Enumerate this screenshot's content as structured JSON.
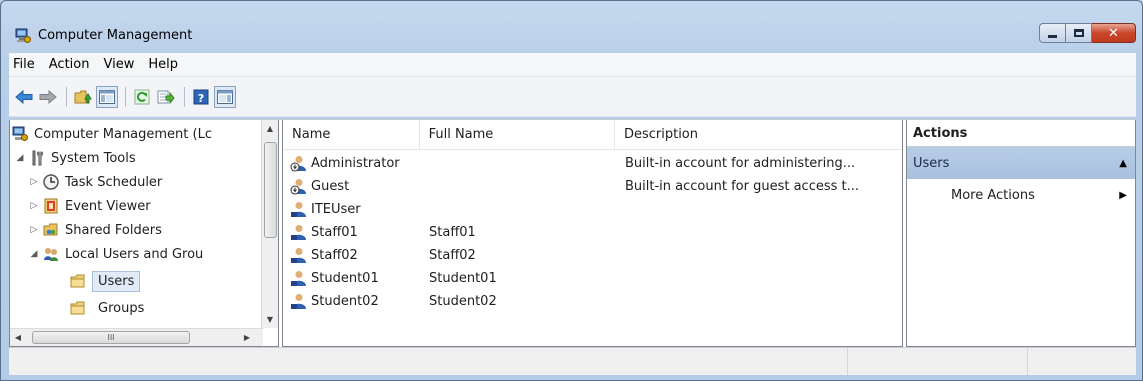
{
  "window": {
    "title": "Computer Management"
  },
  "menu": [
    "File",
    "Action",
    "View",
    "Help"
  ],
  "toolbar": {
    "buttons": [
      "back-arrow-icon",
      "forward-arrow-icon",
      "up-folder-icon",
      "show-hide-tree-icon",
      "refresh-icon",
      "export-list-icon",
      "help-icon",
      "show-hide-action-pane-icon"
    ]
  },
  "tree": {
    "items": [
      {
        "label": "Computer Management (Lc",
        "twisty": "",
        "icon": "computer-management-icon",
        "indent": 0
      },
      {
        "label": "System Tools",
        "twisty": "◢",
        "icon": "system-tools-icon",
        "indent": 1
      },
      {
        "label": "Task Scheduler",
        "twisty": "▷",
        "icon": "clock-icon",
        "indent": 2
      },
      {
        "label": "Event Viewer",
        "twisty": "▷",
        "icon": "event-viewer-icon",
        "indent": 2
      },
      {
        "label": "Shared Folders",
        "twisty": "▷",
        "icon": "shared-folder-icon",
        "indent": 2
      },
      {
        "label": "Local Users and Grou",
        "twisty": "◢",
        "icon": "users-groups-icon",
        "indent": 2
      },
      {
        "label": "Users",
        "twisty": "",
        "icon": "folder-icon",
        "indent": 3,
        "selected": true
      },
      {
        "label": "Groups",
        "twisty": "",
        "icon": "folder-icon",
        "indent": 3
      }
    ],
    "hscroll_thumb_glyph": "III"
  },
  "list": {
    "columns": [
      "Name",
      "Full Name",
      "Description"
    ],
    "rows": [
      {
        "name": "Administrator",
        "full_name": "",
        "description": "Built-in account for administering...",
        "icon": "disabled-user-icon"
      },
      {
        "name": "Guest",
        "full_name": "",
        "description": "Built-in account for guest access t...",
        "icon": "disabled-user-icon"
      },
      {
        "name": "ITEUser",
        "full_name": "",
        "description": "",
        "icon": "user-icon"
      },
      {
        "name": "Staff01",
        "full_name": "Staff01",
        "description": "",
        "icon": "user-icon"
      },
      {
        "name": "Staff02",
        "full_name": "Staff02",
        "description": "",
        "icon": "user-icon"
      },
      {
        "name": "Student01",
        "full_name": "Student01",
        "description": "",
        "icon": "user-icon"
      },
      {
        "name": "Student02",
        "full_name": "Student02",
        "description": "",
        "icon": "user-icon"
      }
    ]
  },
  "actions": {
    "title": "Actions",
    "section": "Users",
    "section_arrow": "▲",
    "items": [
      {
        "label": "More Actions",
        "arrow": "▶"
      }
    ]
  },
  "colors": {
    "selection": "#e0ebf7",
    "action_header": "#b8cde6",
    "close_button": "#c9462b"
  }
}
